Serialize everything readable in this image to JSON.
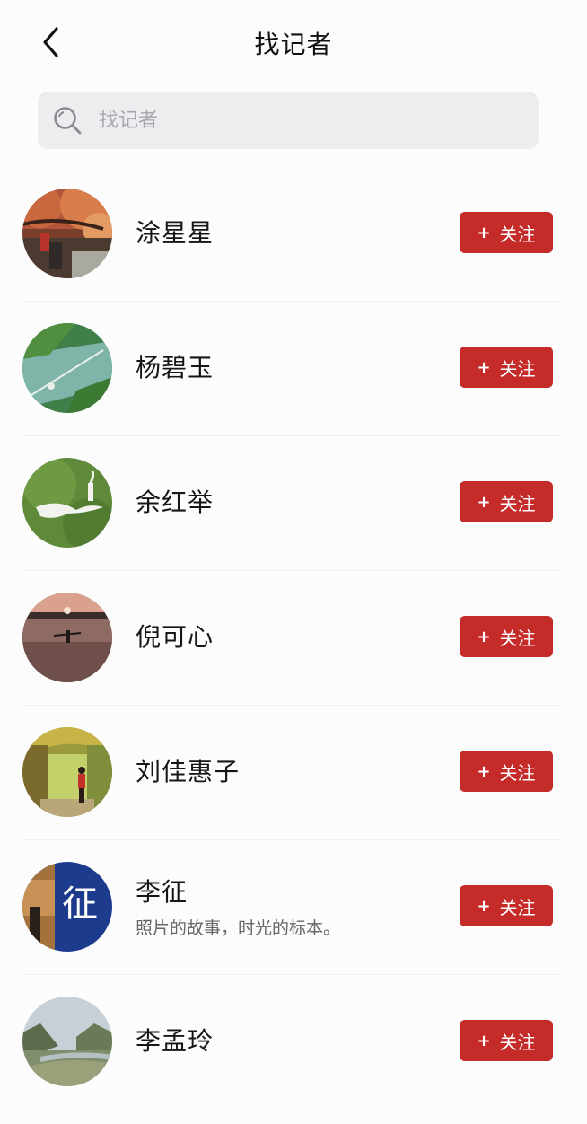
{
  "header": {
    "title": "找记者",
    "back_icon": "chevron-left-icon"
  },
  "search": {
    "placeholder": "找记者",
    "icon": "search-icon"
  },
  "reporters": [
    {
      "name": "涂星星",
      "bio": "",
      "follow_label": "关注",
      "follow_icon": "+"
    },
    {
      "name": "杨碧玉",
      "bio": "",
      "follow_label": "关注",
      "follow_icon": "+"
    },
    {
      "name": "余红举",
      "bio": "",
      "follow_label": "关注",
      "follow_icon": "+"
    },
    {
      "name": "倪可心",
      "bio": "",
      "follow_label": "关注",
      "follow_icon": "+"
    },
    {
      "name": "刘佳惠子",
      "bio": "",
      "follow_label": "关注",
      "follow_icon": "+"
    },
    {
      "name": "李征",
      "bio": "照片的故事，时光的标本。",
      "avatar_text": "征",
      "follow_label": "关注",
      "follow_icon": "+"
    },
    {
      "name": "李孟玲",
      "bio": "",
      "follow_label": "关注",
      "follow_icon": "+"
    }
  ],
  "colors": {
    "accent": "#c42b29",
    "background": "#fcfcfd",
    "search_bg": "#ededf0"
  }
}
